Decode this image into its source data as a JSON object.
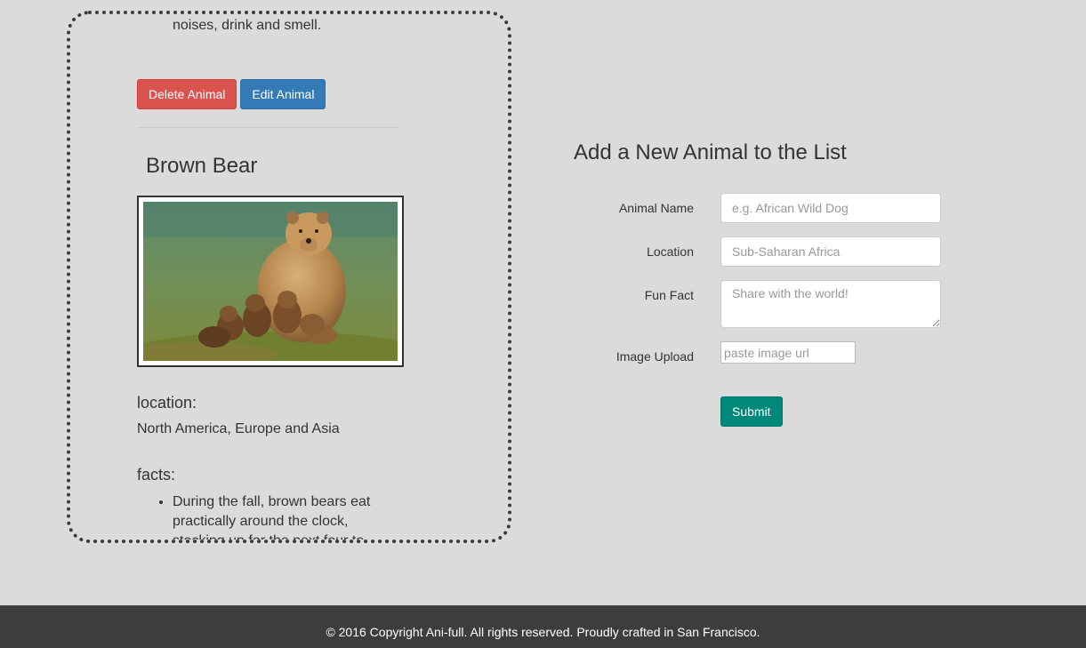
{
  "animal_list": {
    "previous_fact_tail": "noises, drink and smell.",
    "delete_label": "Delete Animal",
    "edit_label": "Edit Animal",
    "animal": {
      "name": "Brown Bear",
      "location_heading": "location:",
      "location": "North America, Europe and Asia",
      "facts_heading": "facts:",
      "facts": [
        "During the fall, brown bears eat practically around the clock, stocking up for the next four to"
      ]
    }
  },
  "form": {
    "title": "Add a New Animal to the List",
    "name_label": "Animal Name",
    "name_placeholder": "e.g. African Wild Dog",
    "location_label": "Location",
    "location_placeholder": "Sub-Saharan Africa",
    "fact_label": "Fun Fact",
    "fact_placeholder": "Share with the world!",
    "image_label": "Image Upload",
    "image_placeholder": "paste image url",
    "submit_label": "Submit"
  },
  "footer": {
    "text": "© 2016 Copyright Ani-full. All rights reserved. Proudly crafted in San Francisco."
  },
  "colors": {
    "background": "#dbdbdb",
    "danger": "#d9534f",
    "primary": "#337ab7",
    "success": "#00897b",
    "footer": "#3d3d3d"
  }
}
